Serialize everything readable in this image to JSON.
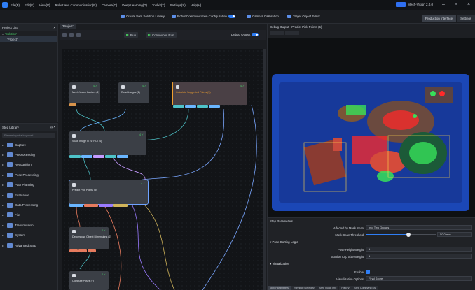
{
  "menubar": {
    "items": [
      "File(F)",
      "Edit(E)",
      "View(V)",
      "Robot and Communication(R)",
      "Camera(C)",
      "Deep Learning(D)",
      "Toolkit(T)",
      "Settings(S)",
      "Help(H)"
    ],
    "brand": "Mech-Vision 2.0.0"
  },
  "toolbar": {
    "create_from_library": "Create from Solution Library",
    "robot_comm_config": "Robot Communication Configuration",
    "camera_calibration": "Camera Calibration",
    "target_object_editor": "Target Object Editor",
    "tab_production": "Production Interface",
    "tab_settings": "Settings"
  },
  "project": {
    "header": "Project List",
    "solution": "‘Solution’",
    "project": "‘Project’"
  },
  "library": {
    "header": "Step Library",
    "search_placeholder": "Please input a keyword",
    "items": [
      "Capture",
      "Preprocessing",
      "Recognition",
      "Pose Processing",
      "Path Planning",
      "Evaluation",
      "Data Processing",
      "File",
      "Transmission",
      "System",
      "Advanced Step"
    ]
  },
  "canvas": {
    "tab": "‘Project’",
    "run": "Run",
    "continuous_run": "Continuous Run",
    "debug_output": "Debug Output",
    "nodes": [
      {
        "id": "n1",
        "title": "Mech-Vision Capture (1)",
        "status": "4 ✓"
      },
      {
        "id": "n2",
        "title": "Read Images (2)",
        "status": "4 ✓"
      },
      {
        "id": "n3",
        "title": "Calculate Suggested Points (3)",
        "status": "4 ✓"
      },
      {
        "id": "n4",
        "title": "Scale Image in 2D ROI (4)",
        "status": "4 ✓"
      },
      {
        "id": "n5",
        "title": "Predict Pick Points (5)",
        "status": "4 ✓"
      },
      {
        "id": "n6",
        "title": "Decompose Object Dimensions (6)",
        "status": "4 ✓"
      },
      {
        "id": "n7",
        "title": "Compute Poses (7)",
        "status": "4 ✓"
      }
    ]
  },
  "debug": {
    "title": "Debug Output - Predict Pick Points (5)"
  },
  "params": {
    "title": "Step Parameters",
    "mask_span_label": "Affected by Mask Span",
    "mask_span_value": "Into Two Groups",
    "mask_threshold_label": "Mask Span Threshold",
    "mask_threshold_value": "50.0 mm",
    "pose_logic_header": "Pose Sorting Logic",
    "pose_height_label": "Pose Height Weight",
    "pose_height_value": "1",
    "suction_label": "Suction Cup Size Weight",
    "suction_value": "1",
    "visualization_header": "Visualization",
    "enable_label": "Enable",
    "vis_options_label": "Visualization Options",
    "vis_options_value": "Final Score",
    "bottom_tabs": [
      "Step Parameters",
      "Running Summary",
      "Step Quick Info",
      "History",
      "Step Command List"
    ]
  },
  "colors": {
    "accent": "#2f7ef5",
    "success": "#49d36b",
    "bin_blue": "#1b47b6",
    "highlight_red": "#ff2a2a",
    "highlight_green": "#37e05a"
  }
}
